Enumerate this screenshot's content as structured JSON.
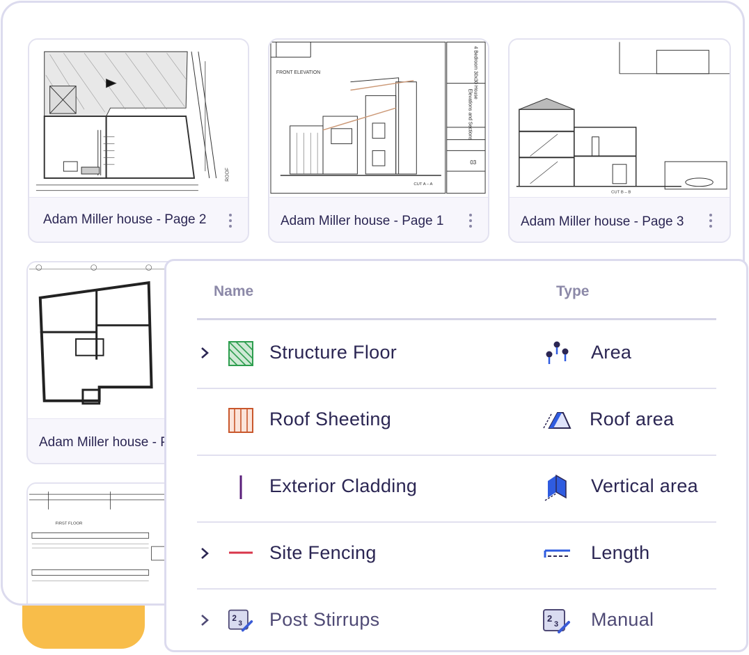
{
  "pages": [
    {
      "label": "Adam Miller house - Page 2"
    },
    {
      "label": "Adam Miller house - Page 1"
    },
    {
      "label": "Adam Miller house - Page 3"
    },
    {
      "label": "Adam Miller house - P"
    }
  ],
  "drawing_text": {
    "front_elevation": "FRONT ELEVATION",
    "cut_a": "CUT A – A",
    "cut_b": "CUT B – B",
    "roof": "ROOF",
    "first_floor": "FIRST FLOOR",
    "sheet_title_1": "4 Bedroom 30x30 House",
    "sheet_title_2": "Elevations and Sections",
    "sheet_number": "03"
  },
  "table": {
    "headers": {
      "name": "Name",
      "type": "Type"
    },
    "rows": [
      {
        "name": "Structure Floor",
        "type": "Area",
        "expandable": true,
        "swatch": "hatch-green-swatch",
        "type_icon": "area-pins-icon",
        "color": "#2e9e4f"
      },
      {
        "name": "Roof Sheeting",
        "type": "Roof area",
        "expandable": false,
        "swatch": "vertical-lines-orange-swatch",
        "type_icon": "roof-area-icon",
        "color": "#c9572c"
      },
      {
        "name": "Exterior Cladding",
        "type": "Vertical area",
        "expandable": false,
        "swatch": "purple-line-swatch",
        "type_icon": "vertical-area-icon",
        "color": "#5a1f7a"
      },
      {
        "name": "Site Fencing",
        "type": "Length",
        "expandable": true,
        "swatch": "red-line-swatch",
        "type_icon": "length-icon",
        "color": "#d8364a"
      },
      {
        "name": "Post Stirrups",
        "type": "Manual",
        "expandable": true,
        "swatch": "count-manual-swatch",
        "type_icon": "manual-count-icon",
        "color": "#3a5bd6"
      }
    ]
  },
  "colors": {
    "accent": "#2f5ce0",
    "text": "#2b2653",
    "border": "#dcdbee",
    "highlight": "#f8bd4a"
  }
}
